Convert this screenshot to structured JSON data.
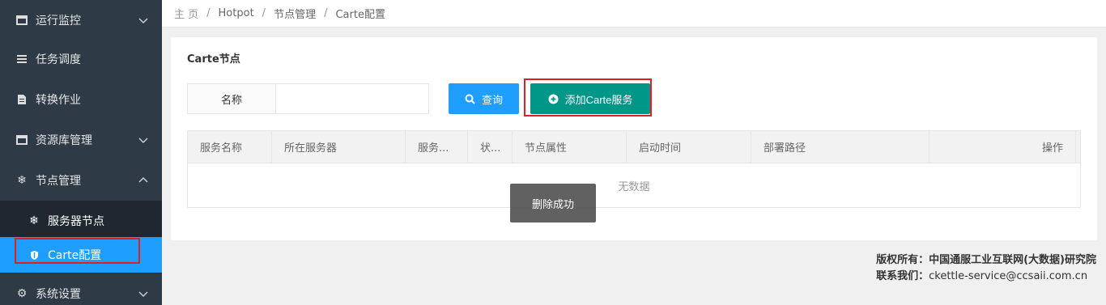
{
  "sidebar": {
    "items": [
      {
        "label": "运行监控",
        "icon": "monitor-icon"
      },
      {
        "label": "任务调度",
        "icon": "list-icon"
      },
      {
        "label": "转换作业",
        "icon": "file-icon"
      },
      {
        "label": "资源库管理",
        "icon": "database-icon"
      },
      {
        "label": "节点管理",
        "icon": "snowflake-icon"
      },
      {
        "label": "系统设置",
        "icon": "gear-icon"
      }
    ],
    "sub_items": [
      {
        "label": "服务器节点",
        "icon": "snowflake-icon"
      },
      {
        "label": "Carte配置",
        "icon": "shield-icon"
      }
    ]
  },
  "breadcrumb": {
    "items": [
      "主 页",
      "Hotpot",
      "节点管理",
      "Carte配置"
    ]
  },
  "panel": {
    "title": "Carte节点",
    "name_label": "名称",
    "name_value": "",
    "query_label": "查询",
    "add_label": "添加Carte服务"
  },
  "table": {
    "columns": [
      "服务名称",
      "所在服务器",
      "服务...",
      "状...",
      "节点属性",
      "启动时间",
      "部署路径",
      "操作"
    ],
    "empty_text": "无数据"
  },
  "toast": "删除成功",
  "footer": {
    "copyright_label": "版权所有：",
    "copyright_value": "中国通服工业互联网(大数据)研究院",
    "contact_label": "联系我们：",
    "contact_value": "ckettle-service@ccsaii.com.cn"
  },
  "colors": {
    "sidebar_bg": "#2f3a47",
    "active": "#1e9fff",
    "add_button": "#009688",
    "highlight": "#e02020"
  }
}
